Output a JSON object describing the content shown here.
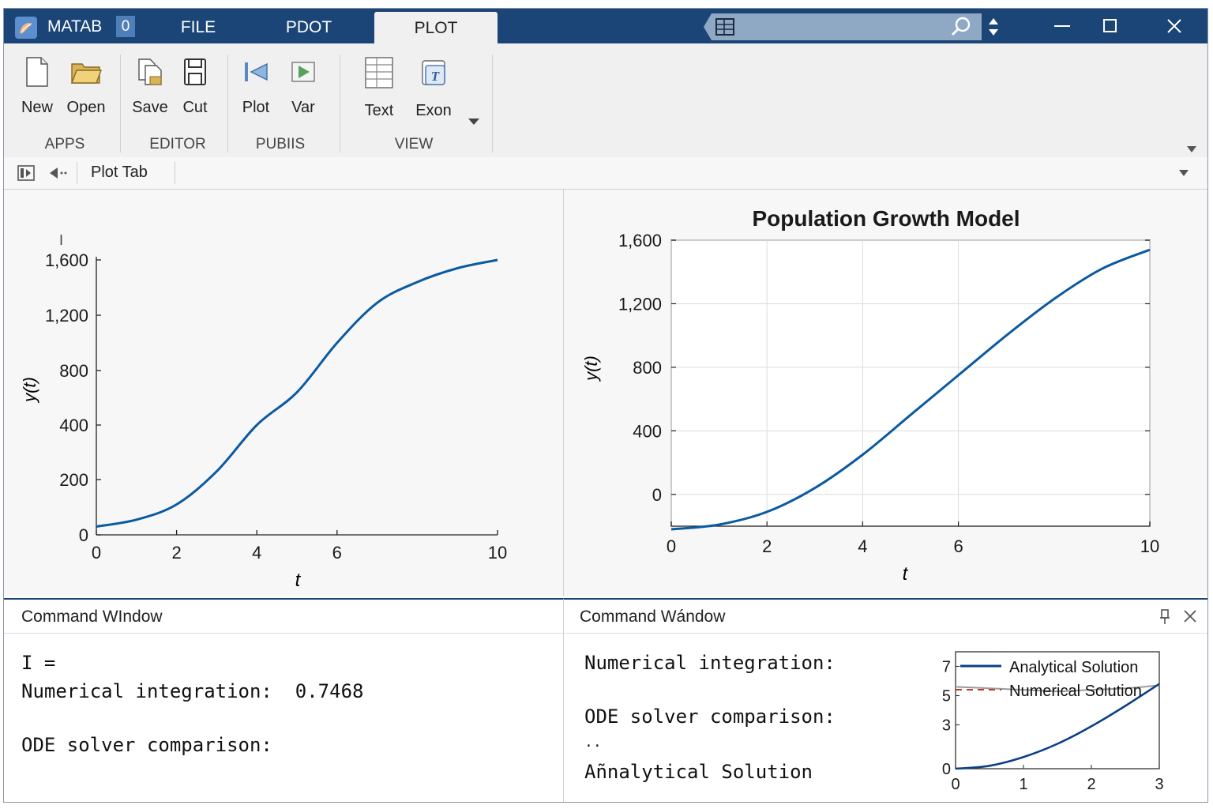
{
  "titlebar": {
    "app_name": "MATAB",
    "badge": "0",
    "tabs": [
      "FILE",
      "PDOT",
      "PLOT"
    ],
    "active_tab": "PLOT"
  },
  "toolstrip": {
    "groups": [
      {
        "label": "APPS",
        "tools": [
          "New",
          "Open"
        ]
      },
      {
        "label": "EDITOR",
        "tools": [
          "Save",
          "Cut"
        ]
      },
      {
        "label": "PUBIIS",
        "tools": [
          "Plot",
          "Var"
        ]
      },
      {
        "label": "VIEW",
        "tools": [
          "Text",
          "Exon"
        ]
      }
    ]
  },
  "addressbar": {
    "label": "Plot Tab"
  },
  "plots": {
    "left": {
      "cursor": "I"
    }
  },
  "chart_data": [
    {
      "type": "line",
      "title": "",
      "xlabel": "t",
      "ylabel": "y(t)",
      "xlim": [
        0,
        10
      ],
      "ylim": [
        0,
        1600
      ],
      "x_ticks": [
        "0",
        "2",
        "4",
        "6",
        "10"
      ],
      "y_ticks": [
        "0",
        "200",
        "400",
        "800",
        "1,200",
        "1,600"
      ],
      "grid": false,
      "x": [
        0,
        1,
        2,
        3,
        4,
        5,
        6,
        7,
        8,
        9,
        10
      ],
      "series": [
        {
          "values": [
            30,
            55,
            110,
            230,
            400,
            640,
            1000,
            1290,
            1440,
            1540,
            1600
          ]
        }
      ],
      "color": "#0b5aa0"
    },
    {
      "type": "line",
      "title": "Population Growth Model",
      "xlabel": "t",
      "ylabel": "y(t)",
      "xlim": [
        0,
        10
      ],
      "ylim": [
        -200,
        1600
      ],
      "x_ticks": [
        "0",
        "2",
        "4",
        "6",
        "10"
      ],
      "y_ticks": [
        "0",
        "400",
        "800",
        "1,200",
        "1,600"
      ],
      "grid": true,
      "x": [
        0,
        1,
        2,
        3,
        4,
        5,
        6,
        7,
        8,
        9,
        10
      ],
      "series": [
        {
          "values": [
            -220,
            -190,
            -110,
            40,
            250,
            500,
            750,
            1000,
            1230,
            1420,
            1540
          ]
        }
      ],
      "color": "#0b5aa0"
    },
    {
      "type": "line",
      "title": "",
      "xlim": [
        0,
        3
      ],
      "ylim": [
        0,
        8
      ],
      "x_ticks": [
        "0",
        "1",
        "2",
        "3"
      ],
      "y_ticks": [
        "0",
        "3",
        "5",
        "7"
      ],
      "legend_position": "top-right",
      "x": [
        0,
        0.5,
        1,
        1.5,
        2,
        2.5,
        3
      ],
      "series": [
        {
          "name": "Analytical Solution",
          "values": [
            0,
            0.2,
            0.8,
            1.7,
            2.9,
            4.3,
            5.8
          ],
          "color": "#0b3f86"
        },
        {
          "name": "Numerical Solution",
          "values": [
            0,
            0.2,
            0.8,
            1.7,
            2.9,
            4.3,
            5.8
          ],
          "color": "#c0392b",
          "dashed": true
        },
        {
          "values": [
            5.6,
            5.5,
            5.4,
            5.3,
            5.4,
            5.5,
            5.7
          ],
          "color": "#9a9a9a"
        }
      ]
    }
  ],
  "command_windows": {
    "left": {
      "title": "Command WIndow",
      "lines": [
        "I =",
        "Numerical integration:  0.7468",
        "",
        "ODE solver comparison:"
      ]
    },
    "right": {
      "title": "Command Wándow",
      "lines": [
        "Numerical integration:",
        "",
        "ODE solver comparison:",
        "..",
        "Añnalytical Solution"
      ]
    }
  }
}
